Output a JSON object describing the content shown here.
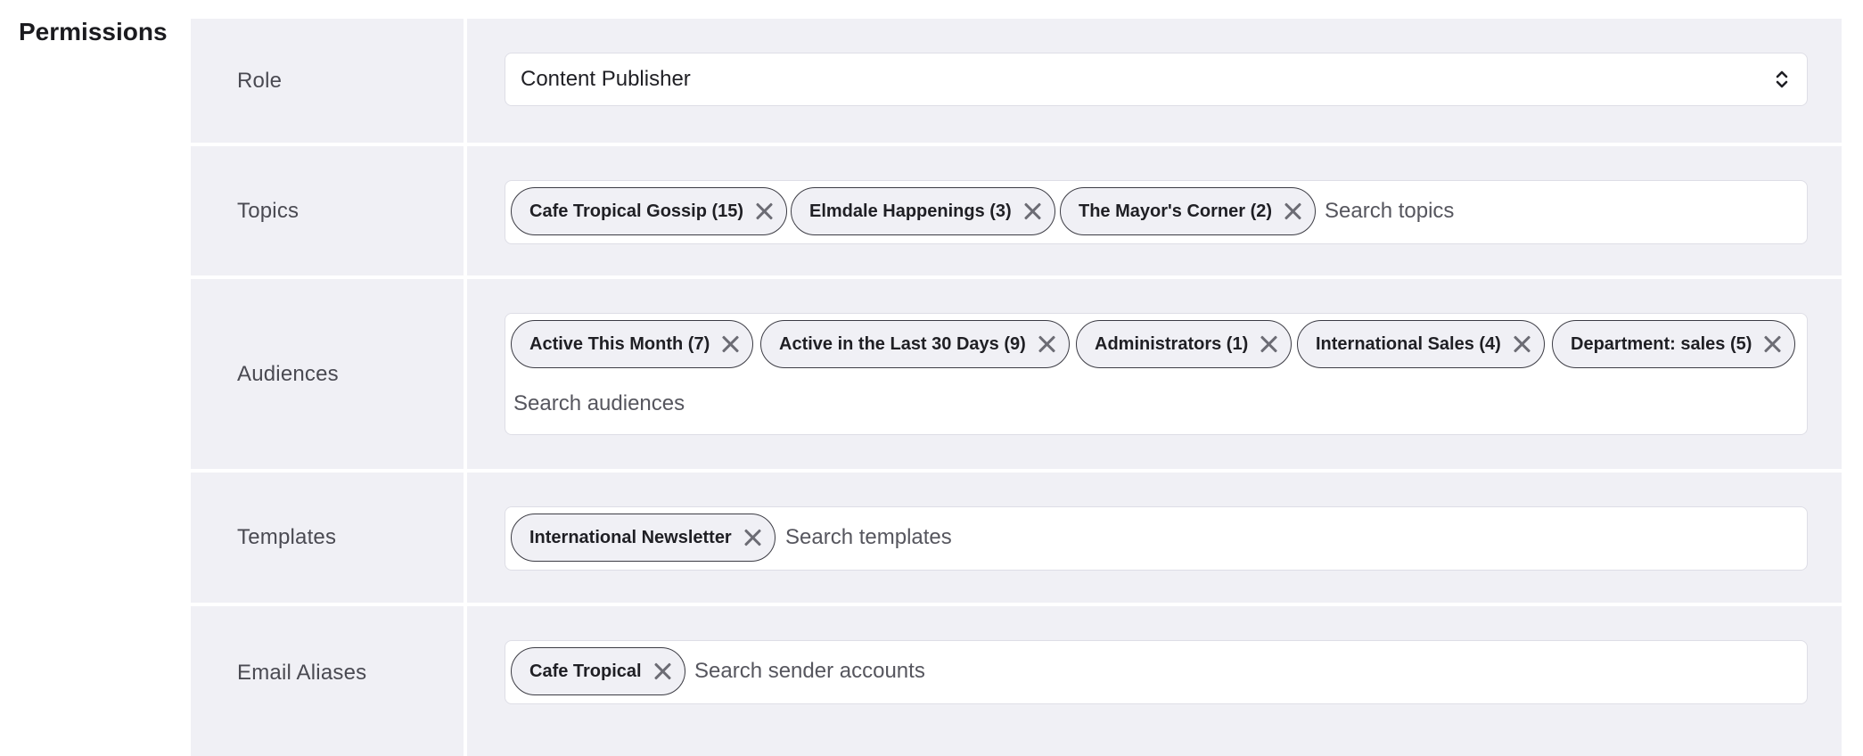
{
  "section": {
    "title": "Permissions"
  },
  "role": {
    "label": "Role",
    "value": "Content Publisher"
  },
  "topics": {
    "label": "Topics",
    "chips": [
      "Cafe Tropical Gossip (15)",
      "Elmdale Happenings (3)",
      "The Mayor's Corner (2)"
    ],
    "placeholder": "Search topics"
  },
  "audiences": {
    "label": "Audiences",
    "chips": [
      "Active This Month (7)",
      "Active in the Last 30 Days (9)",
      "Administrators (1)",
      "International Sales (4)",
      "Department: sales (5)"
    ],
    "placeholder": "Search audiences"
  },
  "templates": {
    "label": "Templates",
    "chips": [
      "International Newsletter"
    ],
    "placeholder": "Search templates"
  },
  "email_aliases": {
    "label": "Email Aliases",
    "chips": [
      "Cafe Tropical"
    ],
    "placeholder": "Search sender accounts"
  },
  "icons": {
    "remove": "close-icon",
    "select": "chevron-up-down-icon"
  },
  "colors": {
    "row_bg": "#f0f0f5",
    "chip_border": "#3c3c44",
    "x_color": "#6c6c74"
  }
}
